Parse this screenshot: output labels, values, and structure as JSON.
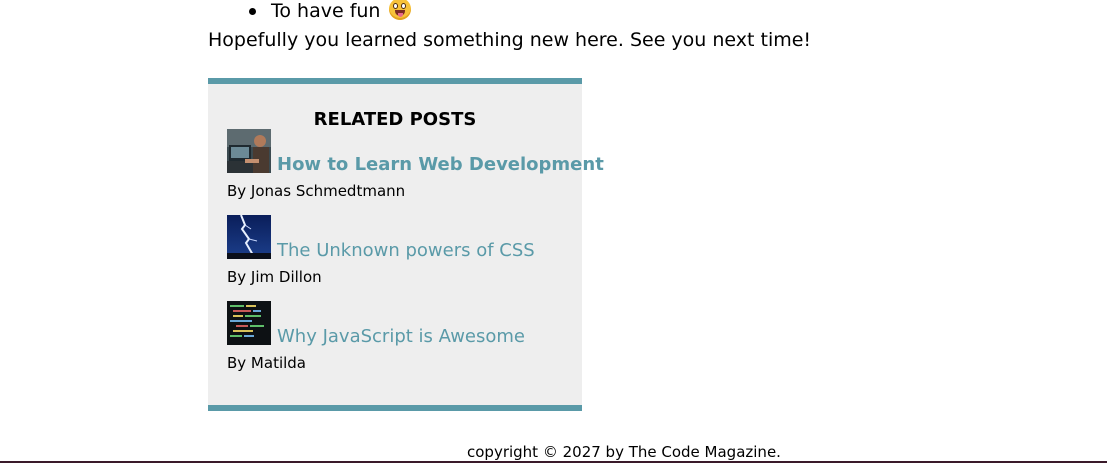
{
  "article": {
    "bullet_items": [
      {
        "text": "To have fun",
        "icon": "grinning-tongue-emoji-icon"
      }
    ],
    "closing_text": "Hopefully you learned something new here. See you next time!"
  },
  "related_posts": {
    "heading": "RELATED POSTS",
    "accent_color": "#5a9aa8",
    "background_color": "#eeeeee",
    "posts": [
      {
        "title": "How to Learn Web Development",
        "author": "By Jonas Schmedtmann",
        "thumbnail": "person-at-laptop-thumbnail"
      },
      {
        "title": "The Unknown powers of CSS",
        "author": "By Jim Dillon",
        "thumbnail": "lightning-thumbnail"
      },
      {
        "title": "Why JavaScript is Awesome",
        "author": "By Matilda",
        "thumbnail": "code-screen-thumbnail"
      }
    ]
  },
  "footer": {
    "copyright": "copyright © 2027 by The Code Magazine."
  }
}
